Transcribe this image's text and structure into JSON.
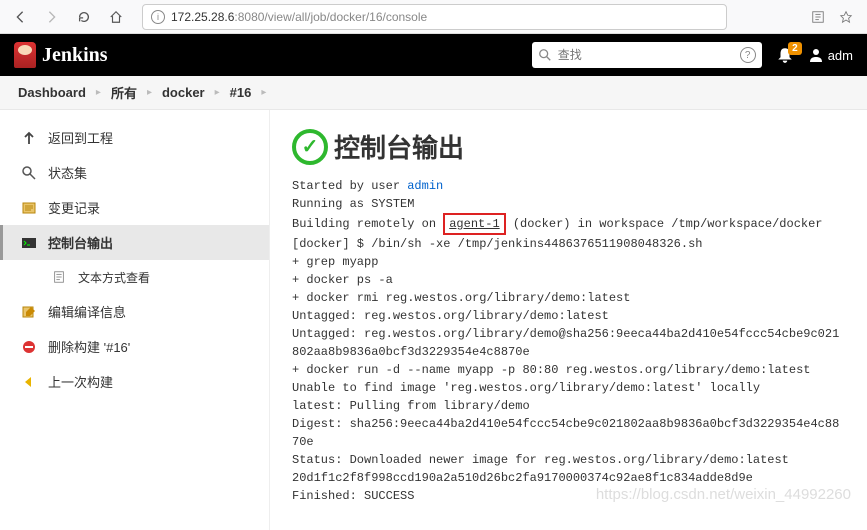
{
  "browser": {
    "url_ip": "172.25.28.6",
    "url_rest": ":8080/view/all/job/docker/16/console"
  },
  "header": {
    "brand": "Jenkins",
    "search_placeholder": "查找",
    "notification_count": "2",
    "username": "adm"
  },
  "breadcrumb": {
    "items": [
      "Dashboard",
      "所有",
      "docker",
      "#16"
    ]
  },
  "sidebar": {
    "items": [
      {
        "label": "返回到工程"
      },
      {
        "label": "状态集"
      },
      {
        "label": "变更记录"
      },
      {
        "label": "控制台输出"
      },
      {
        "label": "文本方式查看"
      },
      {
        "label": "编辑编译信息"
      },
      {
        "label": "删除构建 '#16'"
      },
      {
        "label": "上一次构建"
      }
    ]
  },
  "page": {
    "title": "控制台输出"
  },
  "console": {
    "line1a": "Started by user ",
    "line1b": "admin",
    "line2": "Running as SYSTEM",
    "line3a": "Building remotely on ",
    "line3_agent": "agent-1",
    "line3b": " (docker) in workspace /tmp/workspace/docker",
    "line4": "[docker] $ /bin/sh -xe /tmp/jenkins4486376511908048326.sh",
    "line5": "+ grep myapp",
    "line6": "+ docker ps -a",
    "line7": "+ docker rmi reg.westos.org/library/demo:latest",
    "line8": "Untagged: reg.westos.org/library/demo:latest",
    "line9": "Untagged: reg.westos.org/library/demo@sha256:9eeca44ba2d410e54fccc54cbe9c021802aa8b9836a0bcf3d3229354e4c8870e",
    "line10": "+ docker run -d --name myapp -p 80:80 reg.westos.org/library/demo:latest",
    "line11": "Unable to find image 'reg.westos.org/library/demo:latest' locally",
    "line12": "latest: Pulling from library/demo",
    "line13": "Digest: sha256:9eeca44ba2d410e54fccc54cbe9c021802aa8b9836a0bcf3d3229354e4c8870e",
    "line14": "Status: Downloaded newer image for reg.westos.org/library/demo:latest",
    "line15": "20d1f1c2f8f998ccd190a2a510d26bc2fa9170000374c92ae8f1c834adde8d9e",
    "line16": "Finished: SUCCESS"
  },
  "watermark": "https://blog.csdn.net/weixin_44992260"
}
